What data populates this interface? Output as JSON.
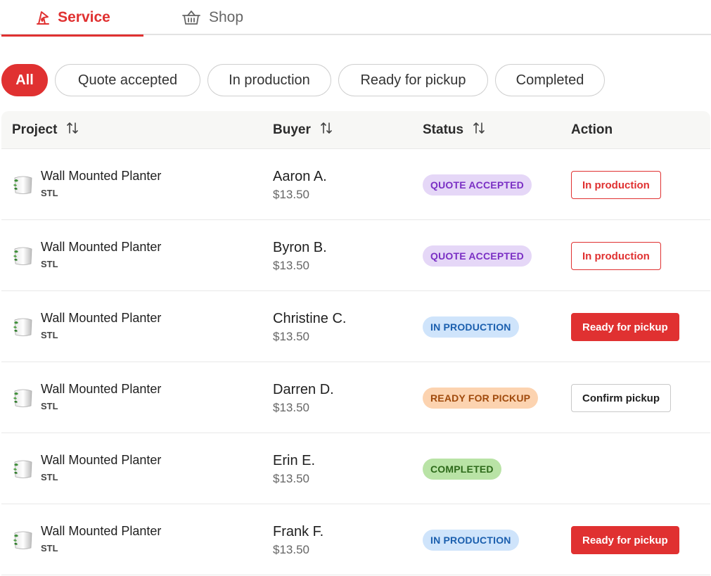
{
  "tabs": [
    {
      "label": "Service",
      "icon": "wizard-hat-icon",
      "active": true
    },
    {
      "label": "Shop",
      "icon": "basket-icon",
      "active": false
    }
  ],
  "filters": [
    {
      "label": "All",
      "active": true
    },
    {
      "label": "Quote accepted",
      "active": false
    },
    {
      "label": "In production",
      "active": false
    },
    {
      "label": "Ready for pickup",
      "active": false
    },
    {
      "label": "Completed",
      "active": false
    }
  ],
  "table": {
    "columns": {
      "project": "Project",
      "buyer": "Buyer",
      "status": "Status",
      "action": "Action"
    },
    "rows": [
      {
        "project": "Wall Mounted Planter",
        "type": "STL",
        "buyer": "Aaron A.",
        "price": "$13.50",
        "status": "QUOTE ACCEPTED",
        "action": "In production"
      },
      {
        "project": "Wall Mounted Planter",
        "type": "STL",
        "buyer": "Byron B.",
        "price": "$13.50",
        "status": "QUOTE ACCEPTED",
        "action": "In production"
      },
      {
        "project": "Wall Mounted Planter",
        "type": "STL",
        "buyer": "Christine C.",
        "price": "$13.50",
        "status": "IN PRODUCTION",
        "action": "Ready for pickup"
      },
      {
        "project": "Wall Mounted Planter",
        "type": "STL",
        "buyer": "Darren D.",
        "price": "$13.50",
        "status": "READY FOR PICKUP",
        "action": "Confirm pickup"
      },
      {
        "project": "Wall Mounted Planter",
        "type": "STL",
        "buyer": "Erin E.",
        "price": "$13.50",
        "status": "COMPLETED",
        "action": ""
      },
      {
        "project": "Wall Mounted Planter",
        "type": "STL",
        "buyer": "Frank F.",
        "price": "$13.50",
        "status": "IN PRODUCTION",
        "action": "Ready for pickup"
      }
    ]
  },
  "colors": {
    "accent": "#e03131",
    "quote_accepted_bg": "#e5d7f7",
    "quote_accepted_fg": "#7a2fc4",
    "in_production_bg": "#cfe4fb",
    "in_production_fg": "#1b5fae",
    "ready_bg": "#fcd3b0",
    "ready_fg": "#a04a0c",
    "completed_bg": "#b9e3a6",
    "completed_fg": "#2d6a1a"
  }
}
